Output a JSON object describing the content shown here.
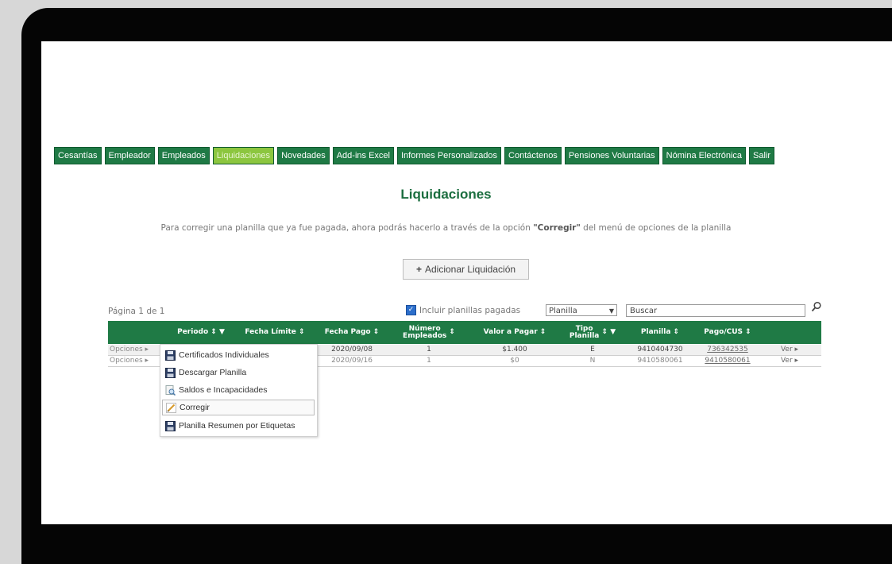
{
  "nav": [
    "Cesantías",
    "Empleador",
    "Empleados",
    "Liquidaciones",
    "Novedades",
    "Add-ins Excel",
    "Informes Personalizados",
    "Contáctenos",
    "Pensiones Voluntarias",
    "Nómina Electrónica",
    "Salir"
  ],
  "nav_active_index": 3,
  "page_title": "Liquidaciones",
  "note": {
    "pre": "Para corregir una planilla que ya fue pagada, ahora podrás hacerlo a través de la opción ",
    "bold": "\"Corregir\"",
    "post": " del menú de opciones de la planilla"
  },
  "add_button": "Adicionar Liquidación",
  "paging": "Página 1 de 1",
  "include_paid": "Incluir planillas pagadas",
  "filter_select": "Planilla",
  "search_placeholder": "Buscar",
  "columns": {
    "periodo": "Periodo ⇕ ▼",
    "fecha_limite": "Fecha Límite ⇕",
    "fecha_pago": "Fecha Pago ⇕",
    "num_emp_1": "Número",
    "num_emp_2": "Empleados",
    "num_emp_sort": "⇕",
    "valor": "Valor a Pagar ⇕",
    "tipo_1": "Tipo",
    "tipo_2": "Planilla",
    "tipo_sort": "⇕ ▼",
    "planilla": "Planilla ⇕",
    "pago": "Pago/CUS ⇕"
  },
  "rows": [
    {
      "opciones": "Opciones ▸",
      "fecha_pago": "2020/09/08",
      "empleados": "1",
      "valor": "$1.400",
      "tipo": "E",
      "planilla": "9410404730",
      "pago": "736342535",
      "ver": "Ver ▸"
    },
    {
      "opciones": "Opciones ▸",
      "fecha_pago": "2020/09/16",
      "empleados": "1",
      "valor": "$0",
      "tipo": "N",
      "planilla": "9410580061",
      "pago": "9410580061",
      "ver": "Ver ▸"
    }
  ],
  "menu": [
    {
      "label": "Certificados Individuales",
      "icon": "floppy-icon"
    },
    {
      "label": "Descargar Planilla",
      "icon": "floppy-icon"
    },
    {
      "label": "Saldos e Incapacidades",
      "icon": "magnifier-document-icon"
    },
    {
      "label": "Corregir",
      "icon": "pencil-icon"
    },
    {
      "label": "Planilla Resumen por Etiquetas",
      "icon": "floppy-icon"
    }
  ],
  "colors": {
    "brand_green": "#1f7a45",
    "active_tab": "#8cc63f"
  }
}
